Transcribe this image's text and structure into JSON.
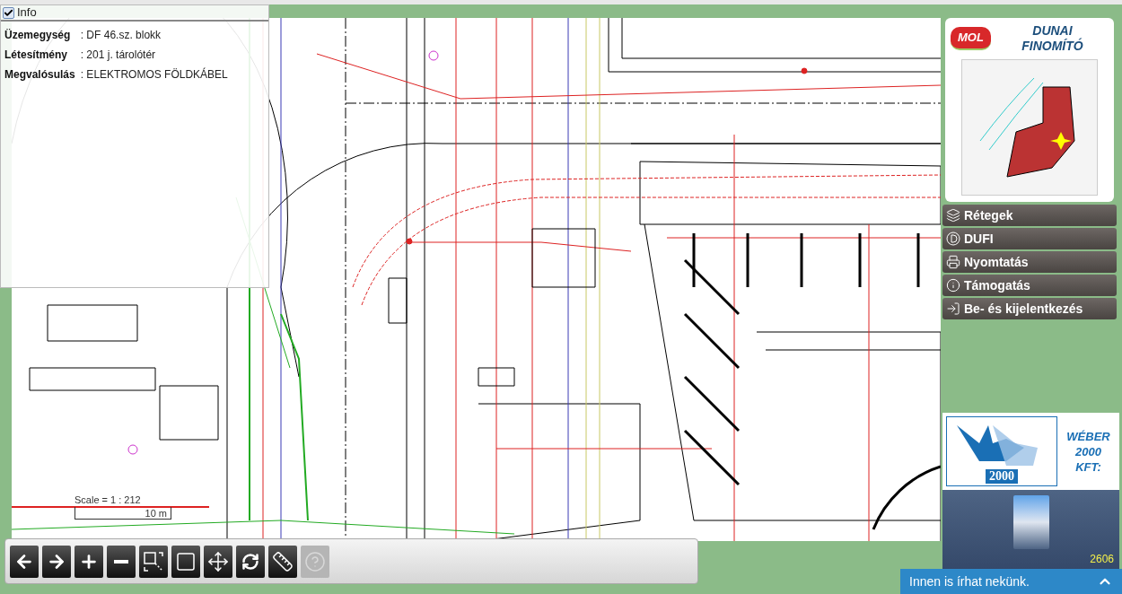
{
  "info": {
    "label": "Info",
    "checked": true,
    "rows": [
      {
        "label": "Üzemegység",
        "value": ": DF 46.sz. blokk"
      },
      {
        "label": "Létesítmény",
        "value": ": 201 j. tárolótér"
      },
      {
        "label": "Megvalósulás",
        "value": ": ELEKTROMOS FÖLDKÁBEL"
      }
    ]
  },
  "scale": {
    "text": "Scale = 1 : 212",
    "bar": "10 m"
  },
  "toolbar": [
    {
      "kind": "back",
      "disabled": false
    },
    {
      "kind": "forward",
      "disabled": false
    },
    {
      "kind": "zoom-in",
      "disabled": false
    },
    {
      "kind": "zoom-out",
      "disabled": false
    },
    {
      "kind": "zoom-box",
      "disabled": false
    },
    {
      "kind": "full-extent",
      "disabled": false
    },
    {
      "kind": "pan",
      "disabled": false
    },
    {
      "kind": "refresh",
      "disabled": false
    },
    {
      "kind": "measure",
      "disabled": false
    },
    {
      "kind": "help",
      "disabled": true
    }
  ],
  "sidebar": {
    "logo": {
      "badge": "MOL",
      "lines": [
        "DUNAI",
        "FINOMÍTÓ"
      ]
    },
    "menu": [
      {
        "kind": "layers",
        "label": "Rétegek"
      },
      {
        "kind": "dufi",
        "label": "DUFI"
      },
      {
        "kind": "print",
        "label": "Nyomtatás"
      },
      {
        "kind": "info",
        "label": "Támogatás"
      },
      {
        "kind": "login",
        "label": "Be- és kijelentkezés"
      }
    ]
  },
  "sponsor": {
    "logo_text": "2000",
    "lines": [
      "WÉBER",
      "2000",
      "KFT:"
    ]
  },
  "counter": "2606",
  "chat": {
    "label": "Innen is írhat nekünk."
  }
}
